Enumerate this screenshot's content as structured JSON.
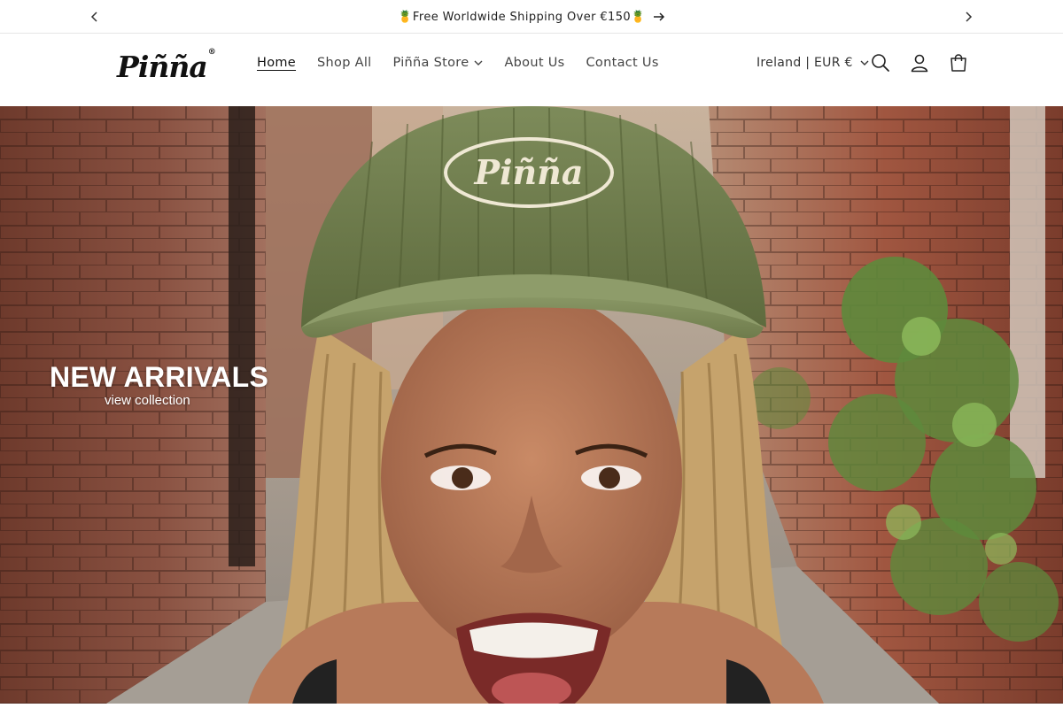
{
  "announcement": {
    "text": "🍍Free Worldwide Shipping Over €150🍍",
    "prev_icon": "chevron-left-icon",
    "next_icon": "chevron-right-icon",
    "link_icon": "arrow-right-icon"
  },
  "header": {
    "logo_text": "Piñña",
    "logo_mark": "®",
    "nav": [
      {
        "label": "Home",
        "active": true
      },
      {
        "label": "Shop All"
      },
      {
        "label": "Piñña Store",
        "has_dropdown": true
      },
      {
        "label": "About Us"
      },
      {
        "label": "Contact Us"
      }
    ],
    "locale": "Ireland | EUR €",
    "icons": [
      "search-icon",
      "account-icon",
      "cart-icon"
    ]
  },
  "hero": {
    "title": "NEW ARRIVALS",
    "subtitle": "view collection",
    "cap_text": "Piñña"
  },
  "colors": {
    "text": "#121212",
    "muted": "#444444",
    "border": "#e6e6e6",
    "brick": "#8a4a3a",
    "cap": "#6b7a4a"
  }
}
